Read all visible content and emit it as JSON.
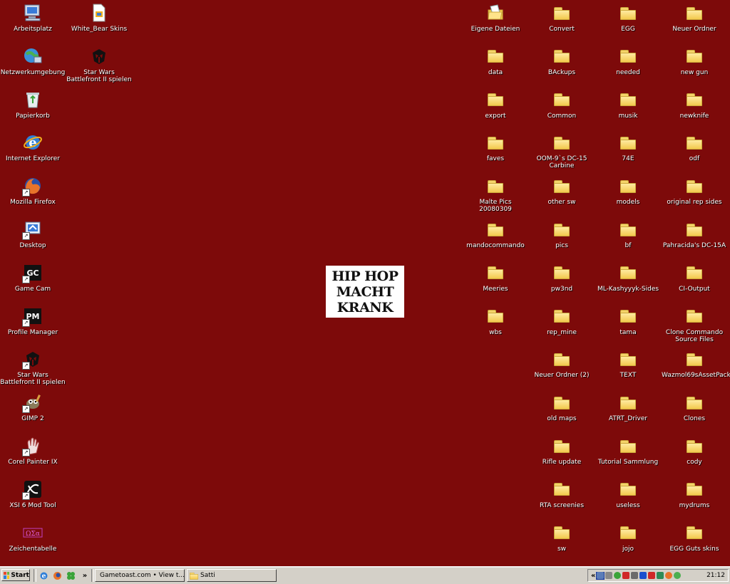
{
  "desktop": {
    "background_color": "#7d0a0a",
    "left_icons": [
      {
        "label": "Arbeitsplatz",
        "icon": "my-computer-icon"
      },
      {
        "label": "Netzwerkumgebung",
        "icon": "network-places-icon"
      },
      {
        "label": "Papierkorb",
        "icon": "recycle-bin-icon"
      },
      {
        "label": "Internet Explorer",
        "icon": "internet-explorer-icon"
      },
      {
        "label": "Mozilla Firefox",
        "icon": "firefox-icon"
      },
      {
        "label": "Desktop",
        "icon": "desktop-shortcut-icon"
      },
      {
        "label": "Game Cam",
        "icon": "game-cam-icon",
        "badge": "GC"
      },
      {
        "label": "Profile Manager",
        "icon": "profile-manager-icon",
        "badge": "PM"
      },
      {
        "label": "Star Wars Battlefront II spielen",
        "icon": "mandalorian-skull-icon"
      },
      {
        "label": "GIMP 2",
        "icon": "gimp-icon"
      },
      {
        "label": "Corel Painter IX",
        "icon": "corel-painter-icon"
      },
      {
        "label": "XSI 6 Mod Tool",
        "icon": "xsi-mod-tool-icon"
      },
      {
        "label": "Zeichentabelle",
        "icon": "character-map-icon"
      }
    ],
    "second_column_icons": [
      {
        "label": "White_Bear Skins",
        "icon": "document-icon"
      },
      {
        "label": "Star Wars Battlefront II spielen",
        "icon": "mandalorian-skull-icon"
      }
    ],
    "folder_columns": [
      [
        "Eigene Dateien",
        "data",
        "export",
        "faves",
        "Malte Pics 20080309",
        "mandocommando",
        "Meeries",
        "wbs"
      ],
      [
        "Convert",
        "BAckups",
        "Common",
        "OOM-9`s DC-15 Carbine",
        "other sw",
        "pics",
        "pw3nd",
        "rep_mine",
        "Neuer Ordner (2)",
        "old maps",
        "Rifle update",
        "RTA screenies",
        "sw"
      ],
      [
        "EGG",
        "needed",
        "musik",
        "74E",
        "models",
        "bf",
        "ML-Kashyyyk-Sides",
        "tama",
        "TEXT",
        "ATRT_Driver",
        "Tutorial Sammlung",
        "useless",
        "jojo"
      ],
      [
        "Neuer Ordner",
        "new gun",
        "newknife",
        "odf",
        "original rep sides",
        "Pahracida's DC-15A",
        "CI-Output",
        "Clone Commando Source Files",
        "Wazmol69sAssetPack2",
        "Clones",
        "cody",
        "mydrums",
        "EGG Guts skins"
      ]
    ],
    "center_logo": {
      "line1": "HIP HOP",
      "line2": "MACHT",
      "line3": "KRANK"
    }
  },
  "taskbar": {
    "start_label": "Start",
    "quick_launch": [
      "internet-explorer-icon",
      "firefox-icon",
      "clover-icon"
    ],
    "overflow_label": "»",
    "tasks": [
      {
        "label": "Gametoast.com • View t...",
        "icon": "firefox-icon"
      },
      {
        "label": "Satti",
        "icon": "folder-icon"
      }
    ],
    "language": "DE",
    "tray_chevron": "«",
    "clock": "21:12"
  }
}
